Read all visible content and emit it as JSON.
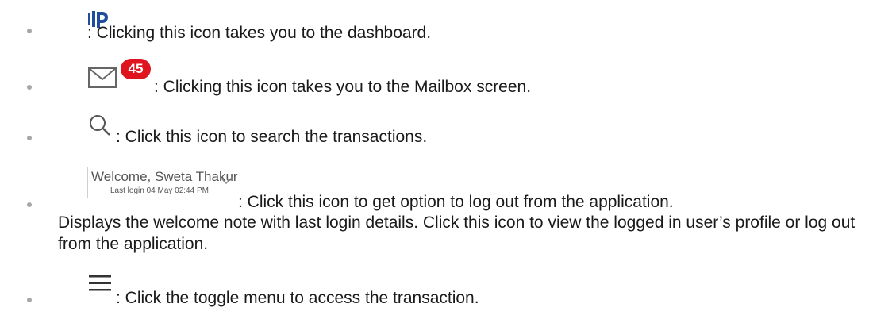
{
  "items": [
    {
      "icon": "dashboard-logo-icon",
      "text": ": Clicking this icon takes you to the dashboard."
    },
    {
      "icon": "mail-icon",
      "badge": "45",
      "text": ": Clicking this icon takes you to the Mailbox screen."
    },
    {
      "icon": "search-icon",
      "text": ": Click this icon to search the transactions."
    },
    {
      "icon": "welcome-dropdown",
      "welcome_title": "Welcome, Sweta Thakur",
      "welcome_subtitle": "Last login 04 May 02:44 PM",
      "text_line1": ": Click this icon to get option to log out from the application.",
      "text_rest": "Displays the welcome note with last login details. Click this icon to view the logged in user’s profile or log out from the application."
    },
    {
      "icon": "hamburger-menu-icon",
      "text": ": Click the toggle menu to access the transaction."
    }
  ],
  "colors": {
    "badge": "#e0141e",
    "logo": "#1f4e9c",
    "text": "#1a1a1a",
    "bullet": "#a7a7a7"
  }
}
